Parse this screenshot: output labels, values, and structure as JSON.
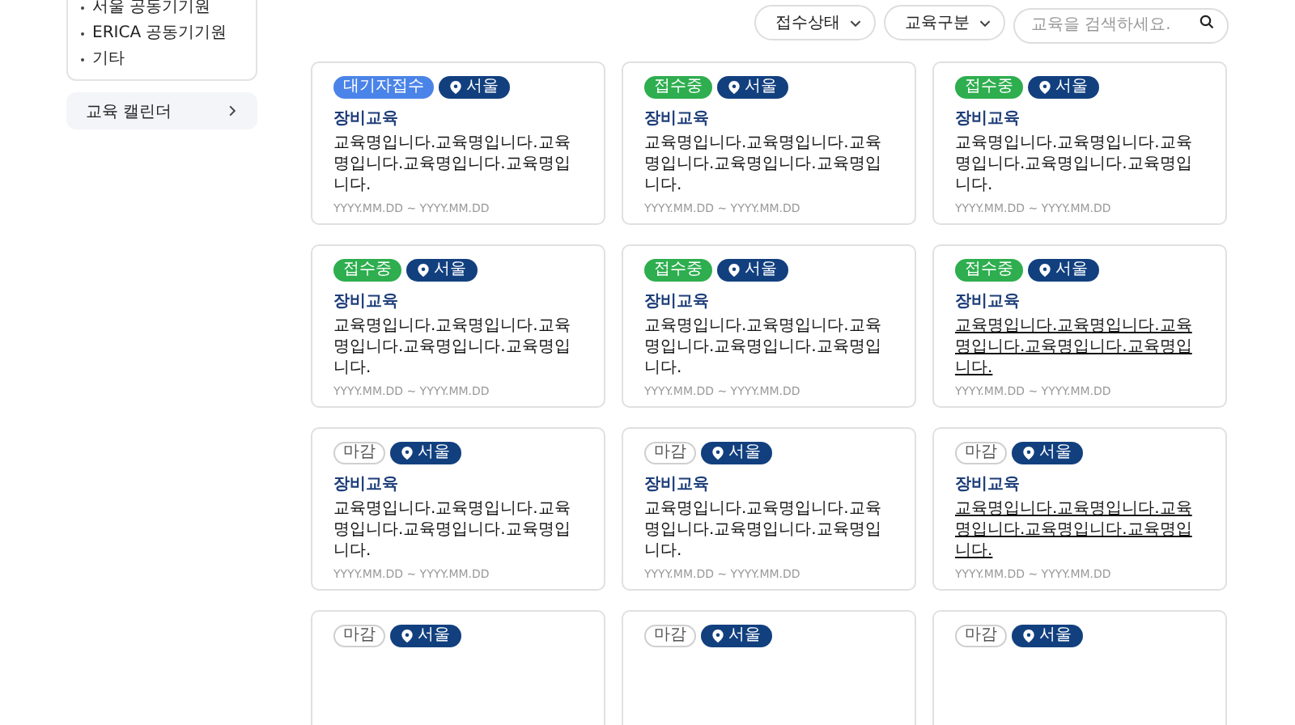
{
  "sidebar": {
    "items": [
      {
        "label": "서울 공동기기원"
      },
      {
        "label": "ERICA 공동기기원"
      },
      {
        "label": "기타"
      }
    ],
    "calendar_link": "교육 캘린더"
  },
  "filters": {
    "dropdowns": [
      {
        "label": "접수상태"
      },
      {
        "label": "교육구분"
      }
    ],
    "search": {
      "placeholder": "교육을 검색하세요."
    }
  },
  "cards": [
    {
      "status": {
        "kind": "waiting",
        "label": "대기자접수"
      },
      "location": "서울",
      "category": "장비교육",
      "title": "교육명입니다.교육명입니다.교육명입니다.교육명입니다.교육명입니다.",
      "underlined": false,
      "dates": "YYYY.MM.DD ~ YYYY.MM.DD"
    },
    {
      "status": {
        "kind": "open",
        "label": "접수중"
      },
      "location": "서울",
      "category": "장비교육",
      "title": "교육명입니다.교육명입니다.교육명입니다.교육명입니다.교육명입니다.",
      "underlined": false,
      "dates": "YYYY.MM.DD ~ YYYY.MM.DD"
    },
    {
      "status": {
        "kind": "open",
        "label": "접수중"
      },
      "location": "서울",
      "category": "장비교육",
      "title": "교육명입니다.교육명입니다.교육명입니다.교육명입니다.교육명입니다.",
      "underlined": false,
      "dates": "YYYY.MM.DD ~ YYYY.MM.DD"
    },
    {
      "status": {
        "kind": "open",
        "label": "접수중"
      },
      "location": "서울",
      "category": "장비교육",
      "title": "교육명입니다.교육명입니다.교육명입니다.교육명입니다.교육명입니다.",
      "underlined": false,
      "dates": "YYYY.MM.DD ~ YYYY.MM.DD"
    },
    {
      "status": {
        "kind": "open",
        "label": "접수중"
      },
      "location": "서울",
      "category": "장비교육",
      "title": "교육명입니다.교육명입니다.교육명입니다.교육명입니다.교육명입니다.",
      "underlined": false,
      "dates": "YYYY.MM.DD ~ YYYY.MM.DD"
    },
    {
      "status": {
        "kind": "open",
        "label": "접수중"
      },
      "location": "서울",
      "category": "장비교육",
      "title": "교육명입니다.교육명입니다.교육명입니다.교육명입니다.교육명입니다.",
      "underlined": true,
      "dates": "YYYY.MM.DD ~ YYYY.MM.DD"
    },
    {
      "status": {
        "kind": "closed",
        "label": "마감"
      },
      "location": "서울",
      "category": "장비교육",
      "title": "교육명입니다.교육명입니다.교육명입니다.교육명입니다.교육명입니다.",
      "underlined": false,
      "dates": "YYYY.MM.DD ~ YYYY.MM.DD"
    },
    {
      "status": {
        "kind": "closed",
        "label": "마감"
      },
      "location": "서울",
      "category": "장비교육",
      "title": "교육명입니다.교육명입니다.교육명입니다.교육명입니다.교육명입니다.",
      "underlined": false,
      "dates": "YYYY.MM.DD ~ YYYY.MM.DD"
    },
    {
      "status": {
        "kind": "closed",
        "label": "마감"
      },
      "location": "서울",
      "category": "장비교육",
      "title": "교육명입니다.교육명입니다.교육명입니다.교육명입니다.교육명입니다.",
      "underlined": true,
      "dates": "YYYY.MM.DD ~ YYYY.MM.DD"
    },
    {
      "status": {
        "kind": "closed",
        "label": "마감"
      },
      "location": "서울"
    },
    {
      "status": {
        "kind": "closed",
        "label": "마감"
      },
      "location": "서울"
    },
    {
      "status": {
        "kind": "closed",
        "label": "마감"
      },
      "location": "서울"
    }
  ]
}
